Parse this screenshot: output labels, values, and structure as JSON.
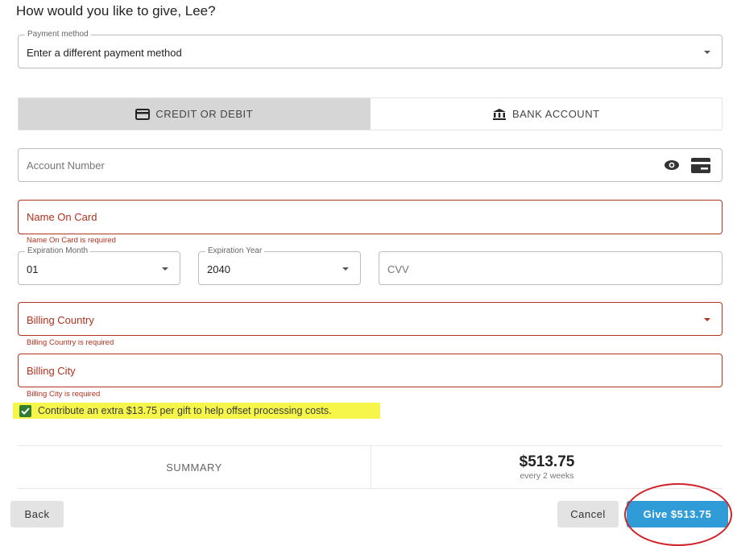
{
  "heading": "How would you like to give, Lee?",
  "payment_method": {
    "label": "Payment method",
    "value": "Enter a different payment method"
  },
  "tabs": [
    {
      "label": "CREDIT OR DEBIT",
      "icon": "credit-card-icon",
      "active": true
    },
    {
      "label": "BANK ACCOUNT",
      "icon": "bank-icon",
      "active": false
    }
  ],
  "account_number": {
    "placeholder": "Account Number"
  },
  "name_on_card": {
    "placeholder": "Name On Card",
    "error": "Name On Card is required"
  },
  "expiration_month": {
    "label": "Expiration Month",
    "value": "01"
  },
  "expiration_year": {
    "label": "Expiration Year",
    "value": "2040"
  },
  "cvv": {
    "placeholder": "CVV"
  },
  "billing_country": {
    "placeholder": "Billing Country",
    "error": "Billing Country is required"
  },
  "billing_city": {
    "placeholder": "Billing City",
    "error": "Billing City is required"
  },
  "processing_fee": {
    "checked": true,
    "label": "Contribute an extra $13.75 per gift to help offset processing costs."
  },
  "summary": {
    "label": "SUMMARY",
    "amount": "$513.75",
    "frequency": "every 2 weeks"
  },
  "buttons": {
    "back": "Back",
    "cancel": "Cancel",
    "give": "Give $513.75"
  },
  "colors": {
    "error": "#b0321f",
    "primary": "#2f9bd7",
    "highlight": "#f6f64a",
    "checkbox": "#2e7d32",
    "annotation": "#d2232a"
  }
}
